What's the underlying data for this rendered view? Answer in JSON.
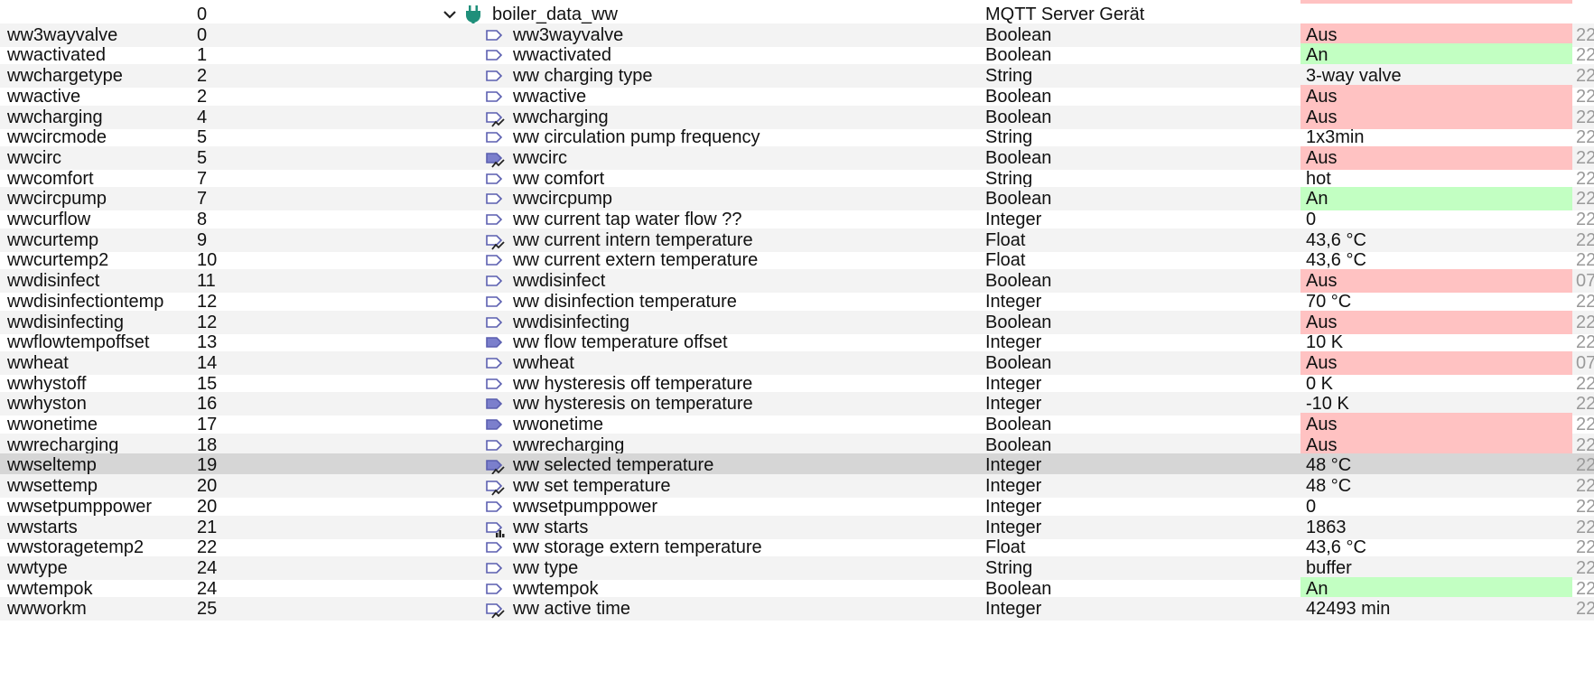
{
  "header_row": {
    "num": "0",
    "folder_name": "boiler_data_ww",
    "folder_type": "MQTT Server Gerät",
    "expanded": true
  },
  "rows": [
    {
      "id": "ww3wayvalve",
      "num": "0",
      "name": "ww3wayvalve",
      "type": "Boolean",
      "value": "Aus",
      "state": "bad",
      "icon": "state-icon",
      "ts": "22"
    },
    {
      "id": "wwactivated",
      "num": "1",
      "name": "wwactivated",
      "type": "Boolean",
      "value": "An",
      "state": "good",
      "icon": "state-icon",
      "ts": "22"
    },
    {
      "id": "wwchargetype",
      "num": "2",
      "name": "ww charging type",
      "type": "String",
      "value": "3-way valve",
      "state": "",
      "icon": "state-icon",
      "ts": "22"
    },
    {
      "id": "wwactive",
      "num": "2",
      "name": "wwactive",
      "type": "Boolean",
      "value": "Aus",
      "state": "bad",
      "icon": "state-icon",
      "ts": "22"
    },
    {
      "id": "wwcharging",
      "num": "4",
      "name": "wwcharging",
      "type": "Boolean",
      "value": "Aus",
      "state": "bad",
      "icon": "state-history-icon",
      "ts": "22"
    },
    {
      "id": "wwcircmode",
      "num": "5",
      "name": "ww circulation pump frequency",
      "type": "String",
      "value": "1x3min",
      "state": "",
      "icon": "state-icon",
      "ts": "22"
    },
    {
      "id": "wwcirc",
      "num": "5",
      "name": "wwcirc",
      "type": "Boolean",
      "value": "Aus",
      "state": "bad",
      "icon": "state-filled-history-icon",
      "ts": "22"
    },
    {
      "id": "wwcomfort",
      "num": "7",
      "name": "ww comfort",
      "type": "String",
      "value": "hot",
      "state": "",
      "icon": "state-icon",
      "ts": "22"
    },
    {
      "id": "wwcircpump",
      "num": "7",
      "name": "wwcircpump",
      "type": "Boolean",
      "value": "An",
      "state": "good",
      "icon": "state-icon",
      "ts": "22"
    },
    {
      "id": "wwcurflow",
      "num": "8",
      "name": "ww current tap water flow ??",
      "type": "Integer",
      "value": "0",
      "state": "",
      "icon": "state-icon",
      "ts": "22"
    },
    {
      "id": "wwcurtemp",
      "num": "9",
      "name": "ww current intern temperature",
      "type": "Float",
      "value": "43,6 °C",
      "state": "",
      "icon": "state-history-icon",
      "ts": "22"
    },
    {
      "id": "wwcurtemp2",
      "num": "10",
      "name": "ww current extern temperature",
      "type": "Float",
      "value": "43,6 °C",
      "state": "",
      "icon": "state-icon",
      "ts": "22"
    },
    {
      "id": "wwdisinfect",
      "num": "11",
      "name": "wwdisinfect",
      "type": "Boolean",
      "value": "Aus",
      "state": "bad",
      "icon": "state-icon",
      "ts": "07"
    },
    {
      "id": "wwdisinfectiontemp",
      "num": "12",
      "name": "ww disinfection temperature",
      "type": "Integer",
      "value": "70 °C",
      "state": "",
      "icon": "state-icon",
      "ts": "22"
    },
    {
      "id": "wwdisinfecting",
      "num": "12",
      "name": "wwdisinfecting",
      "type": "Boolean",
      "value": "Aus",
      "state": "bad",
      "icon": "state-icon",
      "ts": "22"
    },
    {
      "id": "wwflowtempoffset",
      "num": "13",
      "name": "ww flow temperature offset",
      "type": "Integer",
      "value": "10 K",
      "state": "",
      "icon": "state-filled-icon",
      "ts": "22"
    },
    {
      "id": "wwheat",
      "num": "14",
      "name": "wwheat",
      "type": "Boolean",
      "value": "Aus",
      "state": "bad",
      "icon": "state-icon",
      "ts": "07"
    },
    {
      "id": "wwhystoff",
      "num": "15",
      "name": "ww hysteresis off temperature",
      "type": "Integer",
      "value": "0 K",
      "state": "",
      "icon": "state-icon",
      "ts": "22"
    },
    {
      "id": "wwhyston",
      "num": "16",
      "name": "ww hysteresis on temperature",
      "type": "Integer",
      "value": "-10 K",
      "state": "",
      "icon": "state-filled-icon",
      "ts": "22"
    },
    {
      "id": "wwonetime",
      "num": "17",
      "name": "wwonetime",
      "type": "Boolean",
      "value": "Aus",
      "state": "bad",
      "icon": "state-filled-icon",
      "ts": "22"
    },
    {
      "id": "wwrecharging",
      "num": "18",
      "name": "wwrecharging",
      "type": "Boolean",
      "value": "Aus",
      "state": "bad",
      "icon": "state-icon",
      "ts": "22"
    },
    {
      "id": "wwseltemp",
      "num": "19",
      "name": "ww selected temperature",
      "type": "Integer",
      "value": "48 °C",
      "state": "",
      "icon": "state-filled-history-icon",
      "ts": "22",
      "selected": true
    },
    {
      "id": "wwsettemp",
      "num": "20",
      "name": "ww set temperature",
      "type": "Integer",
      "value": "48 °C",
      "state": "",
      "icon": "state-history-icon",
      "ts": "22"
    },
    {
      "id": "wwsetpumppower",
      "num": "20",
      "name": "wwsetpumppower",
      "type": "Integer",
      "value": "0",
      "state": "",
      "icon": "state-icon",
      "ts": "22"
    },
    {
      "id": "wwstarts",
      "num": "21",
      "name": "ww starts",
      "type": "Integer",
      "value": "1863",
      "state": "",
      "icon": "state-chart-icon",
      "ts": "22"
    },
    {
      "id": "wwstoragetemp2",
      "num": "22",
      "name": "ww storage extern temperature",
      "type": "Float",
      "value": "43,6 °C",
      "state": "",
      "icon": "state-icon",
      "ts": "22"
    },
    {
      "id": "wwtype",
      "num": "24",
      "name": "ww type",
      "type": "String",
      "value": "buffer",
      "state": "",
      "icon": "state-icon",
      "ts": "22"
    },
    {
      "id": "wwtempok",
      "num": "24",
      "name": "wwtempok",
      "type": "Boolean",
      "value": "An",
      "state": "good",
      "icon": "state-icon",
      "ts": "22"
    },
    {
      "id": "wwworkm",
      "num": "25",
      "name": "ww active time",
      "type": "Integer",
      "value": "42493 min",
      "state": "",
      "icon": "state-history-icon",
      "ts": "22"
    }
  ],
  "colors": {
    "bad": "#ffc2c2",
    "good": "#c2ffc2",
    "row_alt": "#f3f3f3",
    "selected": "#d6d6d6",
    "state_icon_stroke": "#5b5fb0",
    "state_icon_fill": "#7b7fcc",
    "plug_icon": "#1f8f7a"
  }
}
